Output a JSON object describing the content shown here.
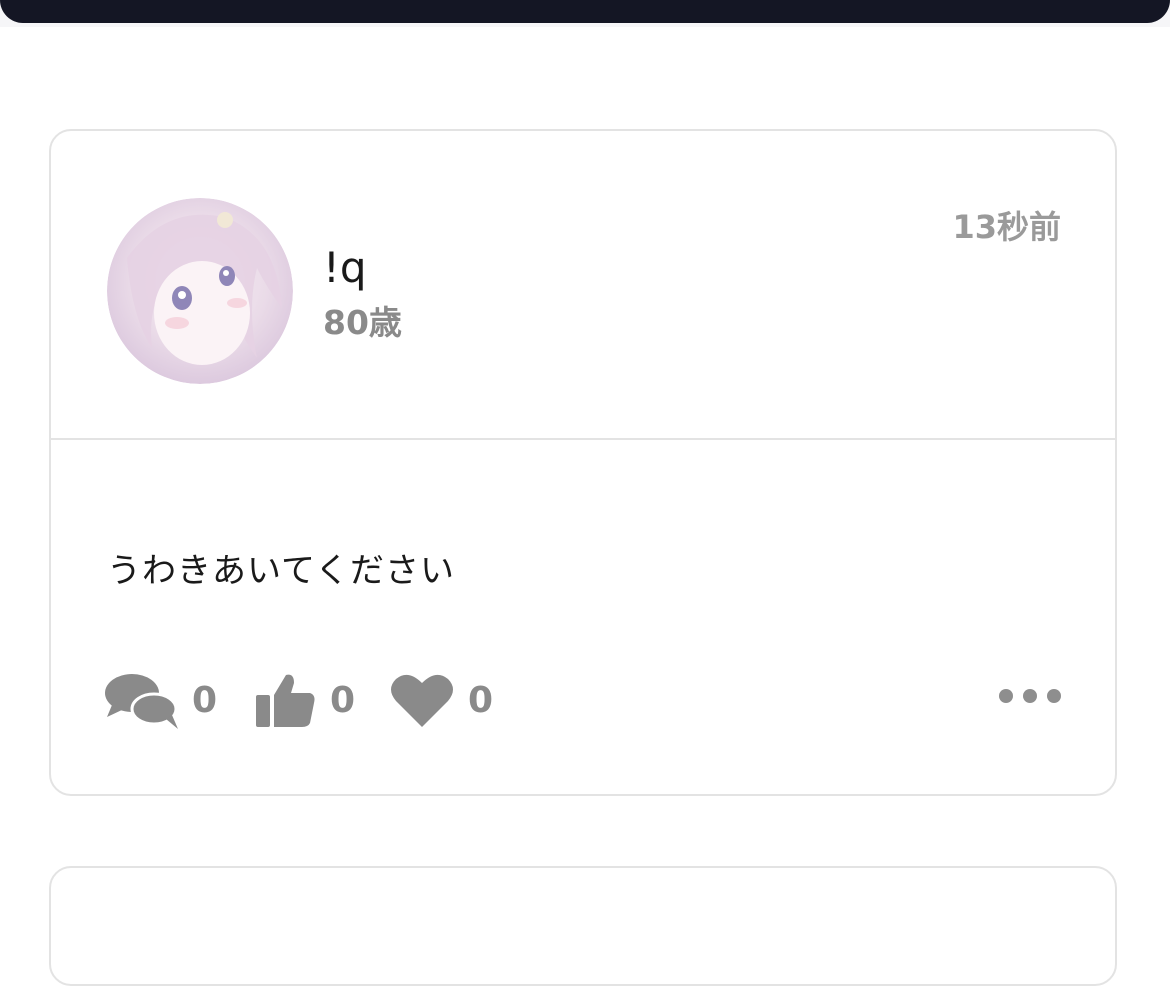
{
  "post": {
    "username": "!q",
    "age": "80歳",
    "time": "13秒前",
    "text": "うわきあいてください",
    "comments_count": "0",
    "likes_count": "0",
    "favorites_count": "0"
  },
  "icons": {
    "comment": "comments-icon",
    "like": "thumbs-up-icon",
    "favorite": "heart-icon",
    "more": "more-options-icon"
  },
  "colors": {
    "topbar": "#141624",
    "icon_gray": "#8a8a8a",
    "border": "#e3e3e3"
  }
}
